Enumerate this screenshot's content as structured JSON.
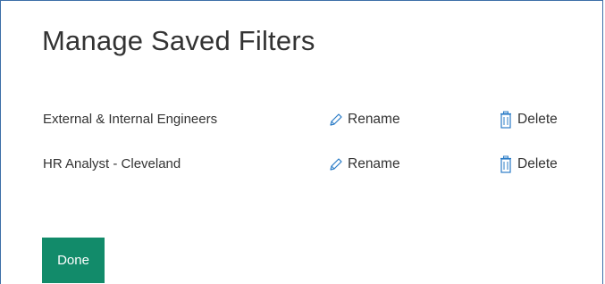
{
  "dialog": {
    "title": "Manage Saved Filters",
    "filters": [
      {
        "name": "External & Internal Engineers",
        "rename_label": "Rename",
        "delete_label": "Delete"
      },
      {
        "name": "HR Analyst - Cleveland",
        "rename_label": "Rename",
        "delete_label": "Delete"
      }
    ],
    "done_label": "Done"
  },
  "icons": {
    "rename": "pencil-icon",
    "delete": "trash-icon"
  },
  "colors": {
    "accent": "#128b6a",
    "border": "#3d6fa8",
    "icon": "#2b7cc7",
    "text": "#333333"
  }
}
